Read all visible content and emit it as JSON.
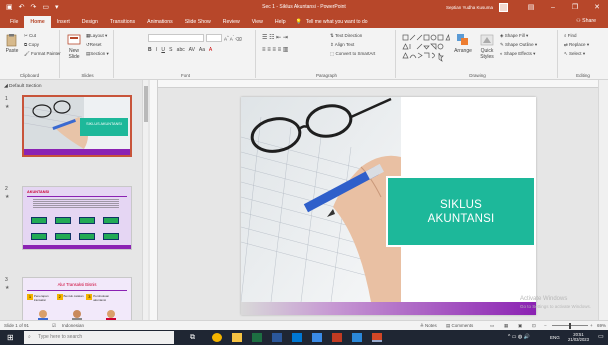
{
  "titlebar": {
    "title": "Sec 1 - Siklus Akuntansi - PowerPoint",
    "user": "Septian Yudha Kusuma",
    "icons": [
      "save-icon",
      "undo-icon",
      "redo-icon",
      "present-icon",
      "customize-icon"
    ],
    "minimize": "–",
    "restore": "❐",
    "close": "✕"
  },
  "tabs": {
    "items": [
      "File",
      "Home",
      "Insert",
      "Design",
      "Transitions",
      "Animations",
      "Slide Show",
      "Review",
      "View",
      "Help"
    ],
    "active": "Home",
    "tellme": "Tell me what you want to do",
    "share": "Share"
  },
  "ribbon": {
    "clipboard": {
      "label": "Clipboard",
      "paste": "Paste",
      "cut": "Cut",
      "copy": "Copy",
      "format_painter": "Format Painter"
    },
    "slides": {
      "label": "Slides",
      "new_slide": "New Slide",
      "layout": "Layout",
      "reset": "Reset",
      "section": "Section"
    },
    "font": {
      "label": "Font",
      "b": "B",
      "i": "I",
      "u": "U",
      "s": "S",
      "abc": "abc",
      "av": "AV",
      "aa": "Aa",
      "a": "A"
    },
    "paragraph": {
      "label": "Paragraph",
      "text_direction": "Text Direction",
      "align_text": "Align Text",
      "smartart": "Convert to SmartArt"
    },
    "drawing": {
      "label": "Drawing",
      "arrange": "Arrange",
      "quick_styles": "Quick Styles",
      "fill": "Shape Fill",
      "outline": "Shape Outline",
      "effects": "Shape Effects"
    },
    "editing": {
      "label": "Editing",
      "find": "Find",
      "replace": "Replace",
      "select": "Select"
    }
  },
  "pane": {
    "section": "Default Section",
    "thumbs": [
      {
        "num": "1",
        "title": "SIKLUS AKUNTANSI"
      },
      {
        "num": "2",
        "title": "AKUNTANSI"
      },
      {
        "num": "3",
        "title": "Alur Transaksi Bisnis",
        "steps": [
          "Penerapan transaksi",
          "Bentuk catatan",
          "Pembukuan akuntansi"
        ]
      }
    ]
  },
  "slide": {
    "title_line1": "SIKLUS",
    "title_line2": "AKUNTANSI",
    "teal": "#1db89a",
    "purple": "#8b22b3"
  },
  "statusbar": {
    "slide_info": "Slide 1 of 91",
    "language": "Indonesian",
    "notes": "Notes",
    "comments": "Comments",
    "zoom": "69%"
  },
  "watermark": {
    "line1": "Activate Windows",
    "line2": "Go to Settings to activate Windows."
  },
  "taskbar": {
    "search_placeholder": "Type here to search",
    "time": "20:51",
    "date": "21/03/2023",
    "lang": "ENG"
  }
}
